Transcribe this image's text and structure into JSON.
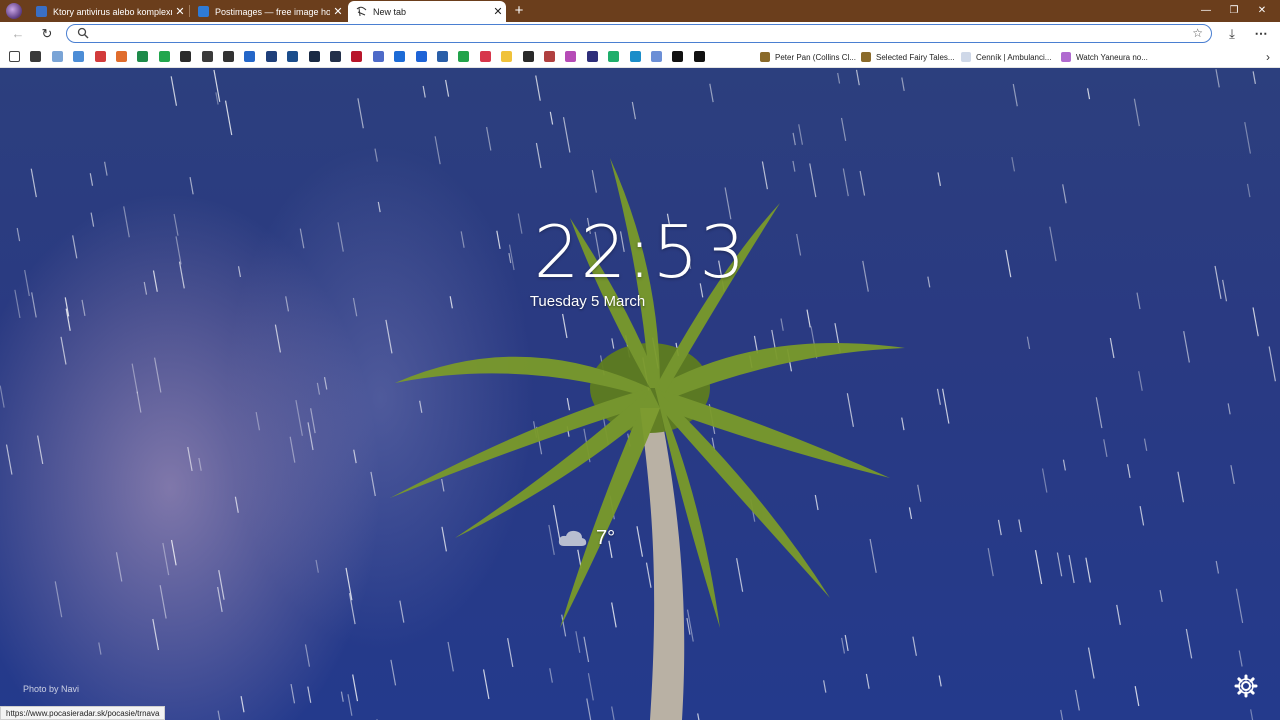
{
  "tabs": [
    {
      "title": "Ktory antivirus alebo komplexne",
      "favicon_color": "#3a6fc4",
      "close": "✕"
    },
    {
      "title": "Postimages — free image hostin",
      "favicon_color": "#2f7bd6",
      "close": "✕"
    },
    {
      "title": "New tab",
      "favicon_color": "#ffffff",
      "close": "✕"
    }
  ],
  "new_tab_symbol": "+",
  "window_controls": {
    "minimize": "—",
    "restore": "❐",
    "close": "✕"
  },
  "toolbar": {
    "back": "←",
    "reload": "↻",
    "address_value": "",
    "address_placeholder": "",
    "star": "☆",
    "download": "⤓",
    "menu": "⋯"
  },
  "bookmarks": {
    "icon_colors": [
      "#ffffff",
      "#3a3a3a",
      "#7aa4d6",
      "#4c8dd6",
      "#d23b3b",
      "#e06c2c",
      "#1e8b4a",
      "#22a64d",
      "#2b2b2b",
      "#3b3b3b",
      "#333",
      "#2466c8",
      "#1f3f7a",
      "#1b4d8c",
      "#1a2a44",
      "#23304a",
      "#b8152a",
      "#4e6ac8",
      "#1d6bd6",
      "#1e63d6",
      "#2a5ea8",
      "#22a34b",
      "#d7364b",
      "#f0c23a",
      "#2a2a2a",
      "#b04040",
      "#b54bb6",
      "#2e2e7a",
      "#1fae6b",
      "#1b8dc9",
      "#6c8fd6",
      "#111",
      "#111"
    ],
    "named": [
      {
        "label": "Peter Pan (Collins Cl...",
        "color": "#8a6a2a"
      },
      {
        "label": "Selected Fairy Tales...",
        "color": "#8a6a2a"
      },
      {
        "label": "Cenník | Ambulanci...",
        "color": "#cfd8e8"
      },
      {
        "label": "Watch Yaneura no...",
        "color": "#b06ad0"
      }
    ],
    "more": "›"
  },
  "clock": {
    "time": "22:53",
    "date": "Tuesday 5 March"
  },
  "weather": {
    "temperature": "7°",
    "icon": "cloud-icon"
  },
  "photo_credit": "Photo by Navi",
  "status_url": "https://www.pocasieradar.sk/pocasie/trnava"
}
